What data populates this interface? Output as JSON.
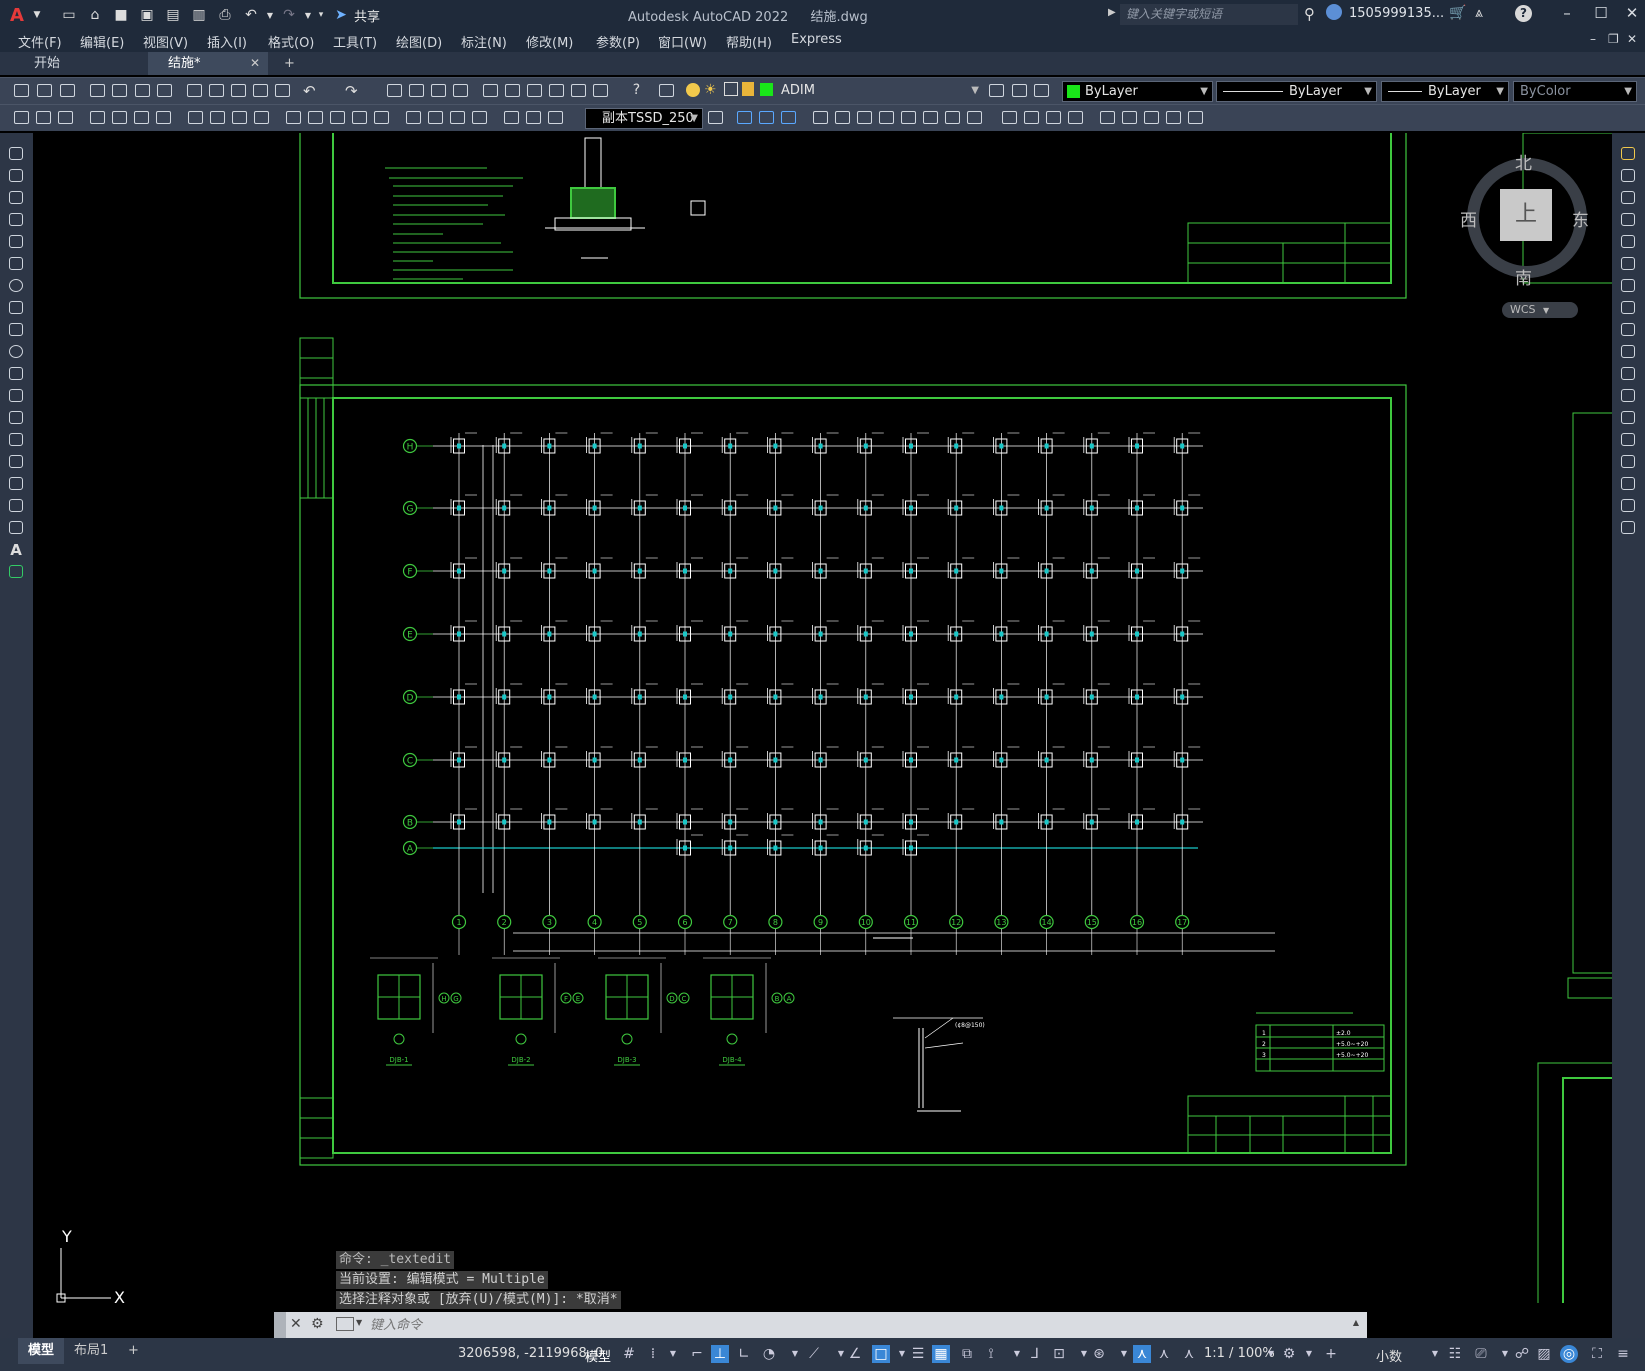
{
  "titlebar": {
    "app_title": "Autodesk AutoCAD 2022",
    "file_name": "结施.dwg",
    "share_label": "共享",
    "search_placeholder": "键入关键字或短语",
    "user_name": "1505999135..."
  },
  "menu": [
    {
      "label": "文件(F)"
    },
    {
      "label": "编辑(E)"
    },
    {
      "label": "视图(V)"
    },
    {
      "label": "插入(I)"
    },
    {
      "label": "格式(O)"
    },
    {
      "label": "工具(T)"
    },
    {
      "label": "绘图(D)"
    },
    {
      "label": "标注(N)"
    },
    {
      "label": "修改(M)"
    },
    {
      "label": "参数(P)"
    },
    {
      "label": "窗口(W)"
    },
    {
      "label": "帮助(H)"
    },
    {
      "label": "Express"
    }
  ],
  "tabs": {
    "start": "开始",
    "active": "结施*",
    "add": "+"
  },
  "properties": {
    "layer": "ADIM",
    "color": "ByLayer",
    "linetype": "ByLayer",
    "lineweight": "ByLayer",
    "plotstyle": "ByColor",
    "textstyle": "副本TSSD_250"
  },
  "viewcube": {
    "north": "北",
    "south": "南",
    "east": "东",
    "west": "西",
    "face": "上",
    "wcs": "WCS"
  },
  "ucs": {
    "x": "X",
    "y": "Y"
  },
  "drawing": {
    "grid_rows": [
      "H",
      "G",
      "F",
      "E",
      "D",
      "C",
      "B",
      "A"
    ],
    "grid_cols": [
      "1",
      "2",
      "3",
      "4",
      "5",
      "6",
      "7",
      "8",
      "9",
      "10",
      "11",
      "12",
      "13",
      "14",
      "15",
      "16",
      "17"
    ],
    "details": [
      "DJB-1",
      "DJB-2",
      "DJB-3",
      "DJB-4"
    ],
    "detail_axes": [
      "H",
      "G",
      "F",
      "E",
      "D",
      "C",
      "B",
      "A"
    ],
    "note_table_rows": [
      "1",
      "2",
      "3"
    ],
    "note_table_vals": [
      "±2.0",
      "+5.0~+20",
      "+5.0~+20"
    ],
    "rebar_label": "(¢8@150)"
  },
  "command": {
    "history": [
      "命令: _textedit",
      "当前设置: 编辑模式 = Multiple",
      "选择注释对象或 [放弃(U)/模式(M)]: *取消*"
    ],
    "placeholder": "键入命令"
  },
  "status": {
    "model_tab": "模型",
    "layout_tab": "布局1",
    "add": "+",
    "coords": "3206598, -2119968, 0",
    "model_label": "模型",
    "scale": "1:1 / 100%",
    "units": "小数"
  },
  "colors": {
    "titlebar": "#1f2a3a",
    "toolbar": "#3a4456",
    "drawing_green": "#3fc93f",
    "axis_cyan": "#19c8c8"
  }
}
